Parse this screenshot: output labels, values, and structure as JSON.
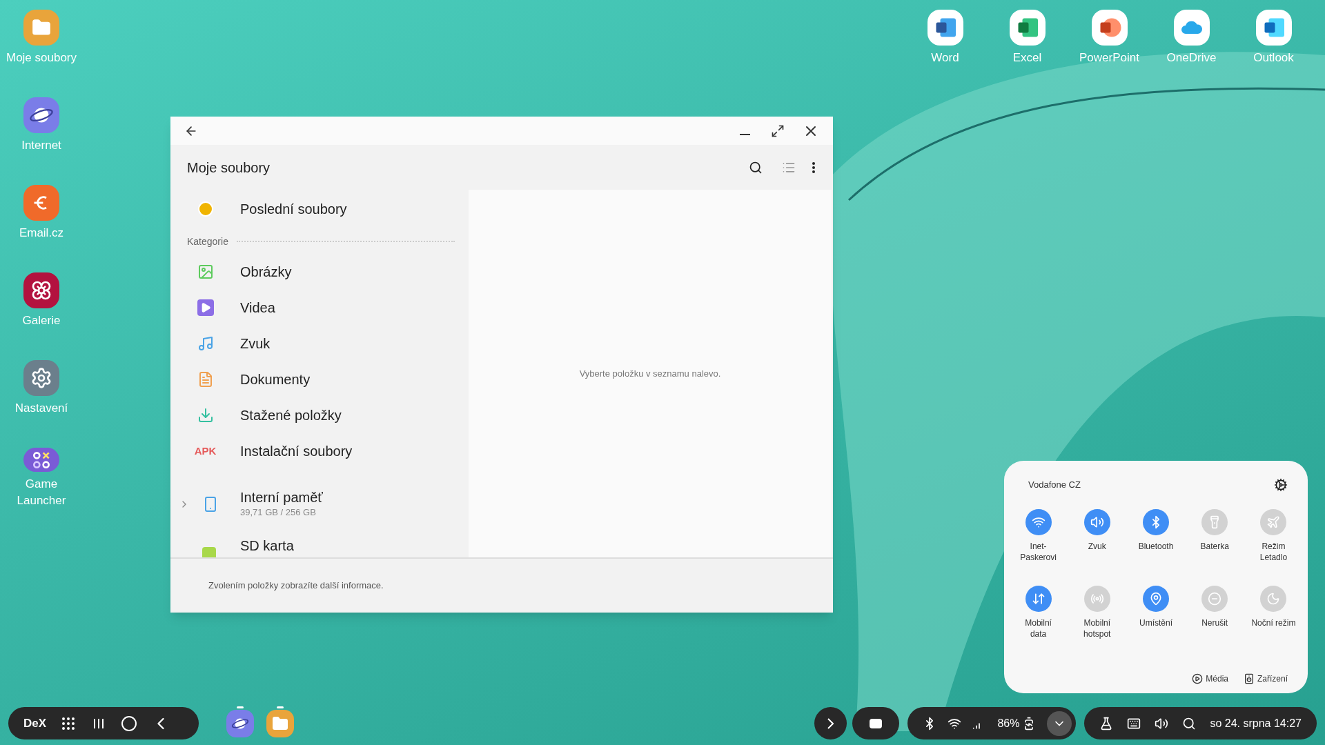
{
  "desktop_icons_left": [
    {
      "label": "Moje soubory",
      "kind": "files"
    },
    {
      "label": "Internet",
      "kind": "internet"
    },
    {
      "label": "Email.cz",
      "kind": "email"
    },
    {
      "label": "Galerie",
      "kind": "gallery"
    },
    {
      "label": "Nastavení",
      "kind": "settings"
    },
    {
      "label": "Game\nLauncher",
      "kind": "game"
    }
  ],
  "desktop_icons_top": [
    {
      "label": "Word",
      "kind": "word"
    },
    {
      "label": "Excel",
      "kind": "excel"
    },
    {
      "label": "PowerPoint",
      "kind": "powerpoint"
    },
    {
      "label": "OneDrive",
      "kind": "onedrive"
    },
    {
      "label": "Outlook",
      "kind": "outlook"
    }
  ],
  "window": {
    "title": "Moje soubory",
    "recent": {
      "label": "Poslední soubory"
    },
    "section": "Kategorie",
    "categories": [
      {
        "label": "Obrázky",
        "kind": "images"
      },
      {
        "label": "Videa",
        "kind": "videos"
      },
      {
        "label": "Zvuk",
        "kind": "audio"
      },
      {
        "label": "Dokumenty",
        "kind": "documents"
      },
      {
        "label": "Stažené položky",
        "kind": "downloads"
      },
      {
        "label": "Instalační soubory",
        "kind": "apk",
        "icon_text": "APK"
      }
    ],
    "storage": [
      {
        "label": "Interní paměť",
        "detail": "39,71 GB / 256 GB",
        "kind": "internal",
        "expanded": false
      },
      {
        "label": "SD karta",
        "kind": "sd"
      }
    ],
    "empty_message": "Vyberte položku v seznamu nalevo.",
    "footer": "Zvolením položky zobrazíte další informace."
  },
  "quick_panel": {
    "network": "Vodafone CZ",
    "toggles": [
      {
        "label": "Inet-\nPaskerovi",
        "kind": "wifi",
        "on": true
      },
      {
        "label": "Zvuk",
        "kind": "sound",
        "on": true
      },
      {
        "label": "Bluetooth",
        "kind": "bluetooth",
        "on": true
      },
      {
        "label": "Baterka",
        "kind": "flashlight",
        "on": false
      },
      {
        "label": "Režim\nLetadlo",
        "kind": "airplane",
        "on": false
      },
      {
        "label": "Mobilní\ndata",
        "kind": "mobile_data",
        "on": true
      },
      {
        "label": "Mobilní\nhotspot",
        "kind": "hotspot",
        "on": false
      },
      {
        "label": "Umístění",
        "kind": "location",
        "on": true
      },
      {
        "label": "Nerušit",
        "kind": "dnd",
        "on": false
      },
      {
        "label": "Noční režim",
        "kind": "night",
        "on": false
      }
    ],
    "links": [
      {
        "label": "Média",
        "kind": "media"
      },
      {
        "label": "Zařízení",
        "kind": "devices"
      }
    ]
  },
  "taskbar": {
    "logo": "DeX",
    "pinned": [
      {
        "kind": "internet",
        "running": true
      },
      {
        "kind": "files",
        "running": true
      }
    ],
    "battery": "86%",
    "datetime": "so 24. srpna 14:27"
  }
}
